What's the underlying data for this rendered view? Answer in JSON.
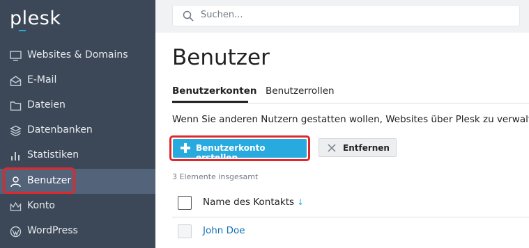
{
  "brand": {
    "logo_text": "plesk",
    "accent": "#28aade"
  },
  "sidebar": {
    "items": [
      {
        "label": "Websites & Domains",
        "icon": "monitor-icon"
      },
      {
        "label": "E-Mail",
        "icon": "mail-icon"
      },
      {
        "label": "Dateien",
        "icon": "folder-icon"
      },
      {
        "label": "Datenbanken",
        "icon": "database-icon"
      },
      {
        "label": "Statistiken",
        "icon": "bar-chart-icon"
      },
      {
        "label": "Benutzer",
        "icon": "user-icon",
        "active": true
      },
      {
        "label": "Konto",
        "icon": "crown-icon"
      },
      {
        "label": "WordPress",
        "icon": "wordpress-icon"
      }
    ]
  },
  "search": {
    "placeholder": "Suchen..."
  },
  "page": {
    "title": "Benutzer",
    "tabs": [
      {
        "label": "Benutzerkonten",
        "active": true
      },
      {
        "label": "Benutzerrollen",
        "active": false
      }
    ],
    "description": "Wenn Sie anderen Nutzern gestatten wollen, Websites über Plesk zu verwalten"
  },
  "toolbar": {
    "create_label": "Benutzerkonto erstellen",
    "remove_label": "Entfernen"
  },
  "list": {
    "count_text": "3 Elemente insgesamt",
    "column_header": "Name des Kontakts",
    "sort_indicator": "↓",
    "rows": [
      {
        "name": "John Doe"
      }
    ]
  },
  "colors": {
    "sidebar_bg": "#3c4858",
    "sidebar_active": "#52637a",
    "highlight": "#e0282c",
    "link": "#0e6fb5"
  }
}
